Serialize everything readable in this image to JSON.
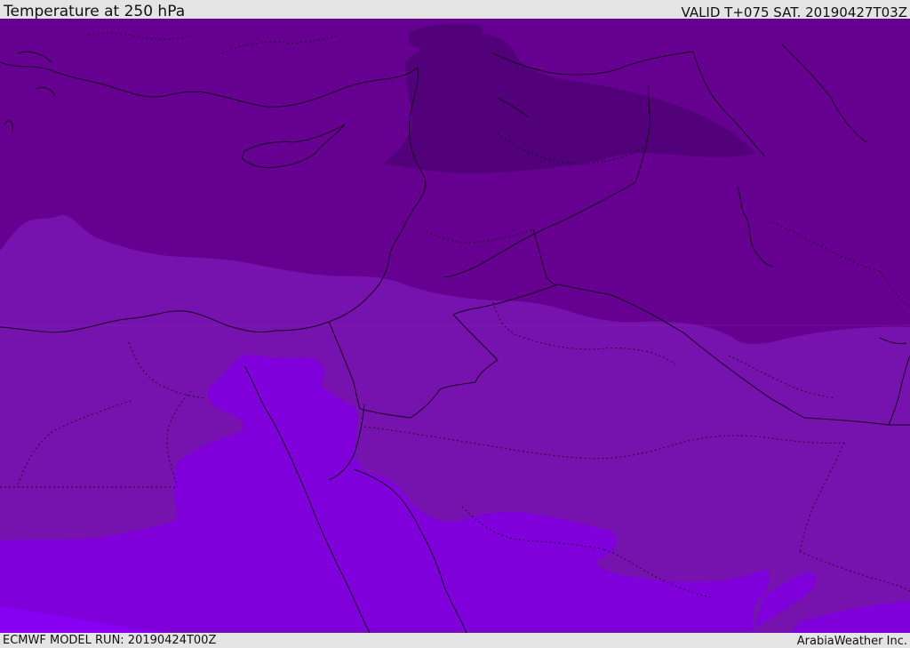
{
  "header": {
    "title": "Temperature at 250 hPa",
    "valid_time": "VALID T+075 SAT. 20190427T03Z"
  },
  "footer": {
    "model_run": "ECMWF MODEL RUN: 20190424T00Z",
    "credit": "ArabiaWeather Inc."
  },
  "map": {
    "variable": "temperature",
    "pressure_level": "250 hPa",
    "colors": {
      "band_coldest": "#52007a",
      "band_cold": "#660090",
      "band_mid": "#7612ad",
      "band_warm": "#7f00da",
      "band_warmest": "#8800f2",
      "coastline": "#1b0022",
      "border_dotted": "#1b0022"
    }
  }
}
